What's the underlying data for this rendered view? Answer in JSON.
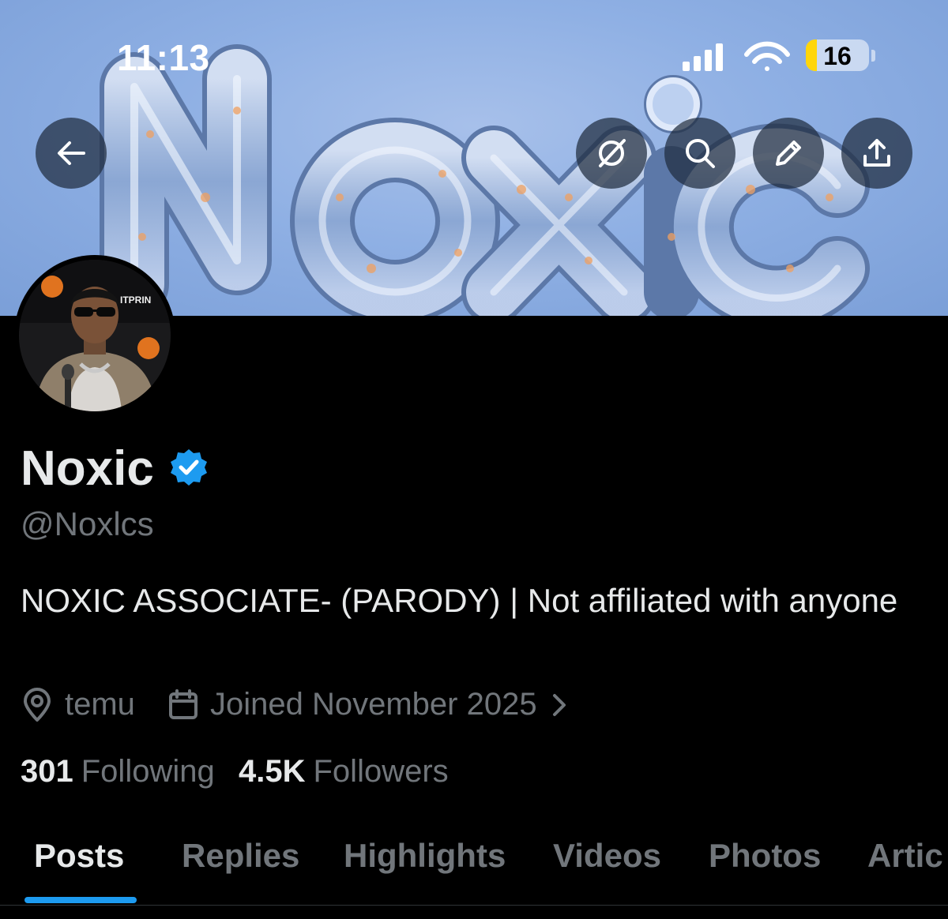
{
  "status_bar": {
    "time": "11:13",
    "battery_level": "16"
  },
  "banner": {
    "wordmark": "Noxic",
    "colors": {
      "sky": "#8fb0e4",
      "glass": "#c8d8f2",
      "highlight": "#f0a060"
    }
  },
  "header_actions": {
    "back_icon": "arrow-left-icon",
    "icons": [
      "grok-icon",
      "search-icon",
      "pencil-icon",
      "share-icon"
    ]
  },
  "profile": {
    "display_name": "Noxic",
    "verified_badge": "verified-badge-icon",
    "handle": "@Noxlcs",
    "bio": "NOXIC ASSOCIATE- (PARODY) | Not affiliated with anyone",
    "location": "temu",
    "joined": "Joined November 2025",
    "following_count": "301",
    "following_label": "Following",
    "followers_count": "4.5K",
    "followers_label": "Followers",
    "avatar_logo_text": "ITPRIN"
  },
  "tabs": [
    {
      "label": "Posts",
      "active": true
    },
    {
      "label": "Replies",
      "active": false
    },
    {
      "label": "Highlights",
      "active": false
    },
    {
      "label": "Videos",
      "active": false
    },
    {
      "label": "Photos",
      "active": false
    },
    {
      "label": "Artic",
      "active": false
    }
  ],
  "colors": {
    "accent": "#1d9bf0",
    "background": "#000000",
    "text": "#e7e9ea",
    "muted": "#71767b"
  }
}
